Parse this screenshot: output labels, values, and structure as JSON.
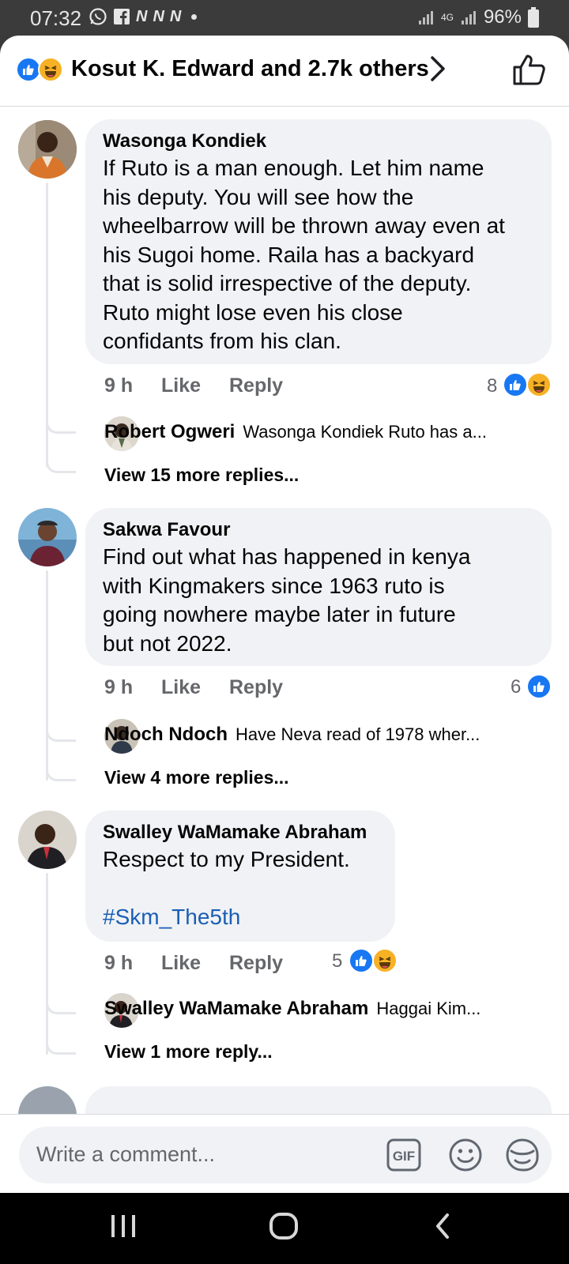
{
  "status_bar": {
    "time": "07:32",
    "notif_icons": [
      "whatsapp-icon",
      "facebook-icon",
      "n-icon",
      "n-icon",
      "n-icon",
      "dot"
    ],
    "signal_label": "4G",
    "battery": "96%"
  },
  "header": {
    "reaction_icons": [
      "like-icon",
      "haha-icon"
    ],
    "summary": "Kosut K. Edward and 2.7k others"
  },
  "comments": [
    {
      "author": "Wasonga Kondiek",
      "text": "If Ruto is a man enough. Let him name\nhis deputy. You will see how the\nwheelbarrow will be thrown away even at\nhis Sugoi home. Raila has a backyard\nthat is solid irrespective of the deputy.\nRuto might lose even his close\nconfidants from his clan.",
      "age": "9 h",
      "like_label": "Like",
      "reply_label": "Reply",
      "reaction_count": "8",
      "reactions": [
        "like",
        "haha"
      ],
      "reply_preview": {
        "author": "Robert Ogweri",
        "text": "Wasonga Kondiek Ruto has a..."
      },
      "view_more": "View 15 more replies..."
    },
    {
      "author": "Sakwa Favour",
      "text": "Find out what has happened  in kenya\nwith Kingmakers since 1963 ruto is\ngoing  nowhere  maybe  later in future\nbut not 2022.",
      "age": "9 h",
      "like_label": "Like",
      "reply_label": "Reply",
      "reaction_count": "6",
      "reactions": [
        "like"
      ],
      "reply_preview": {
        "author": "Ndoch Ndoch",
        "text": "Have Neva read of 1978 wher..."
      },
      "view_more": "View 4 more replies..."
    },
    {
      "author": "Swalley WaMamake Abraham",
      "text": "Respect to my President.",
      "hashtag": "#Skm_The5th",
      "age": "9 h",
      "like_label": "Like",
      "reply_label": "Reply",
      "reaction_count": "5",
      "reactions": [
        "like",
        "haha"
      ],
      "reply_preview": {
        "author": "Swalley WaMamake Abraham",
        "text": "Haggai Kim..."
      },
      "view_more": "View 1 more reply..."
    }
  ],
  "composer": {
    "placeholder": "Write a comment...",
    "gif_label": "GIF"
  },
  "nav": [
    "recent-apps-icon",
    "home-icon",
    "back-icon"
  ],
  "colors": {
    "like_blue": "#1877f2",
    "haha_yellow": "#f7b125",
    "bubble_bg": "#f0f2f5",
    "hashtag": "#1a5fb4",
    "secondary_text": "#65676b"
  }
}
